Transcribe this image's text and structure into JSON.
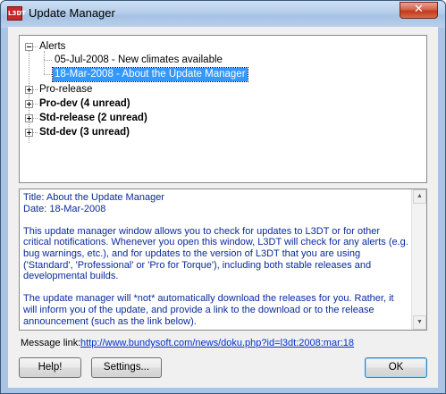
{
  "window": {
    "title": "Update Manager",
    "app_icon_text": "L3DT",
    "close_glyph": "✕"
  },
  "tree": {
    "alerts": {
      "label": "Alerts",
      "children": [
        "05-Jul-2008 - New climates available",
        "18-Mar-2008 - About the Update Manager"
      ],
      "selected_index": 1
    },
    "nodes": [
      {
        "label": "Pro-release",
        "bold": false
      },
      {
        "label": "Pro-dev (4 unread)",
        "bold": true
      },
      {
        "label": "Std-release (2 unread)",
        "bold": true
      },
      {
        "label": "Std-dev (3 unread)",
        "bold": true
      }
    ]
  },
  "message": {
    "title_line": "Title: About the Update Manager",
    "date_line": "Date: 18-Mar-2008",
    "paragraph1": "This update manager window allows you to check for updates to L3DT or for other critical notifications. Whenever you open this window, L3DT will check for any alerts (e.g. bug warnings, etc.), and for updates to the version of L3DT that you are using ('Standard', 'Professional' or 'Pro for Torque'), including both stable releases and developmental builds.",
    "paragraph2": "The update manager will *not* automatically download the releases for you. Rather, it will inform you of the update, and provide a link to the download or to the release announcement (such as the link below)."
  },
  "link": {
    "label": "Message link:",
    "url": "http://www.bundysoft.com/news/doku.php?id=l3dt:2008:mar:18"
  },
  "buttons": {
    "help": "Help!",
    "settings": "Settings...",
    "ok": "OK"
  },
  "colors": {
    "message_text": "#0a2a9c",
    "selection": "#3399ff",
    "link": "#0033cc"
  }
}
